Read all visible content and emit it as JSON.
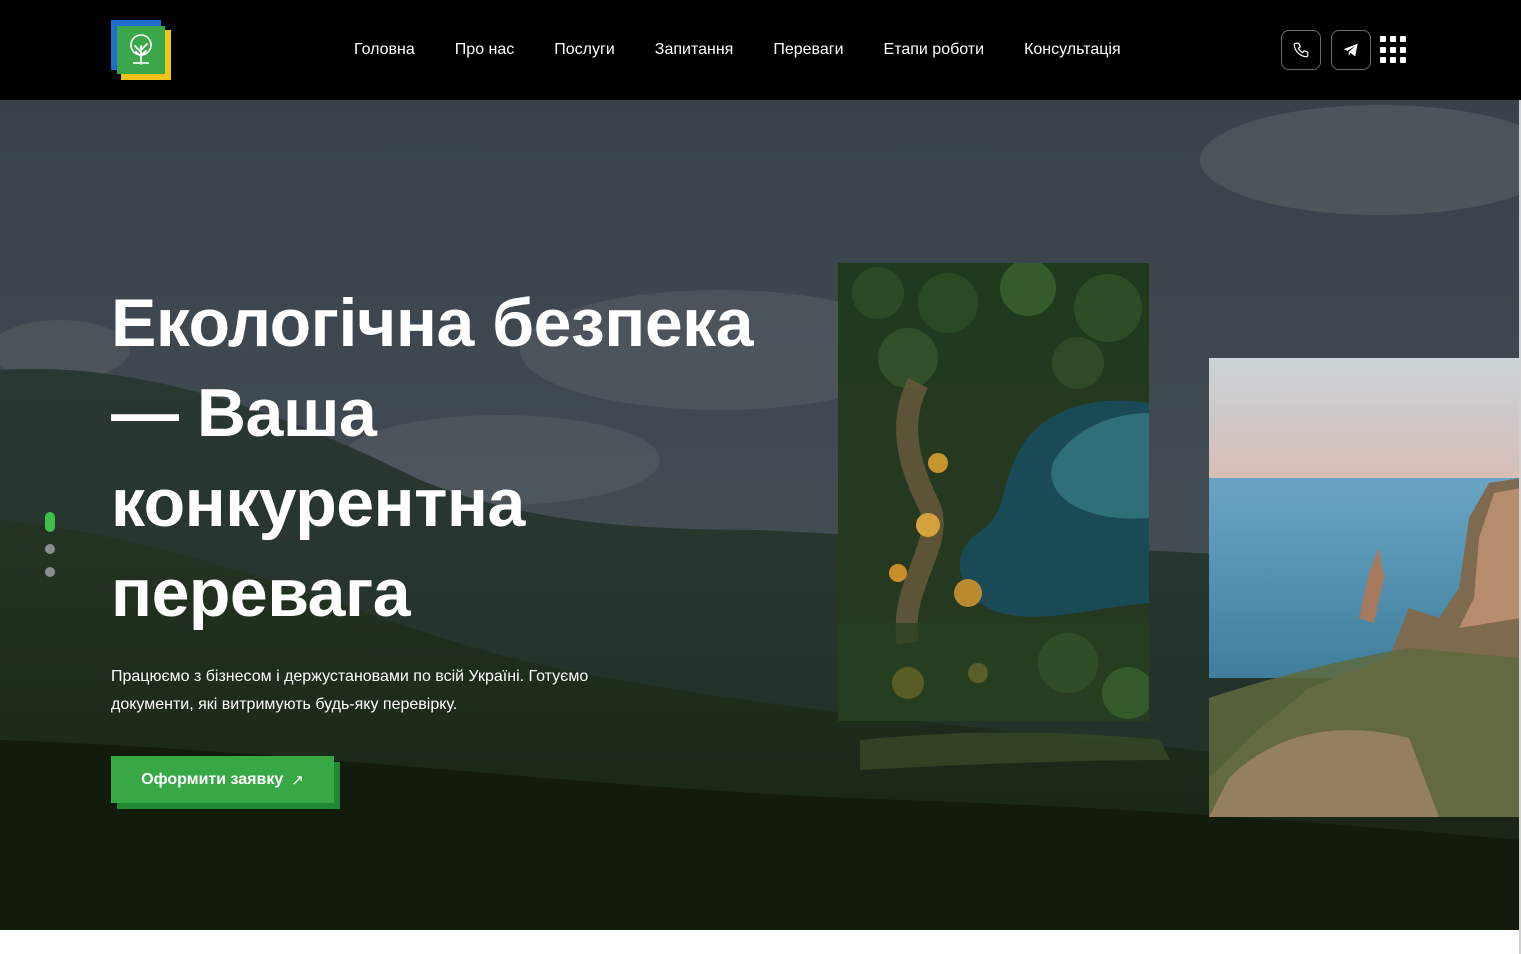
{
  "header": {
    "logo_icon": "tree-in-square-logo",
    "nav": [
      {
        "label": "Головна"
      },
      {
        "label": "Про нас"
      },
      {
        "label": "Послуги"
      },
      {
        "label": "Запитання"
      },
      {
        "label": "Переваги"
      },
      {
        "label": "Етапи роботи"
      },
      {
        "label": "Консультація"
      }
    ],
    "actions": {
      "phone_icon": "phone-icon",
      "telegram_icon": "telegram-icon",
      "menu_icon": "grid-menu-icon"
    }
  },
  "hero": {
    "title_lines": [
      "Екологічна безпека",
      "— Ваша",
      "конкурентна",
      "перевага"
    ],
    "subtitle_lines": [
      "Працюємо з бізнесом і держустановами по всій Україні. Готуємо",
      "документи, які витримують будь-яку перевірку."
    ],
    "cta_label": "Оформити заявку",
    "cta_icon": "arrow-up-right-icon",
    "slider": {
      "count": 3,
      "active": 1
    },
    "images": [
      "aerial-forest-lake-photo",
      "coastal-cliff-sea-photo"
    ]
  },
  "colors": {
    "header_bg": "#000000",
    "accent_green": "#38a846",
    "logo_blue": "#1f6fd1",
    "logo_yellow": "#f2c318"
  }
}
